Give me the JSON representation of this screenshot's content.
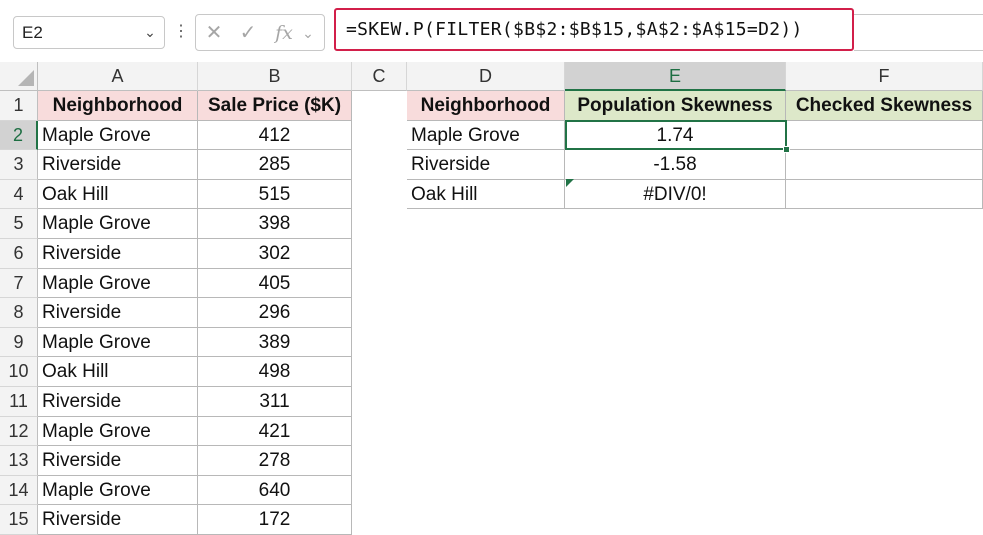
{
  "formula_bar": {
    "name_box": "E2",
    "cancel_icon": "✕",
    "enter_icon": "✓",
    "fx_icon": "fx",
    "formula": "=SKEW.P(FILTER($B$2:$B$15,$A$2:$A$15=D2))"
  },
  "columns": [
    "A",
    "B",
    "C",
    "D",
    "E",
    "F"
  ],
  "rows": [
    "1",
    "2",
    "3",
    "4",
    "5",
    "6",
    "7",
    "8",
    "9",
    "10",
    "11",
    "12",
    "13",
    "14",
    "15"
  ],
  "table_left": {
    "headers": [
      "Neighborhood",
      "Sale Price ($K)"
    ],
    "data": [
      [
        "Maple Grove",
        "412"
      ],
      [
        "Riverside",
        "285"
      ],
      [
        "Oak Hill",
        "515"
      ],
      [
        "Maple Grove",
        "398"
      ],
      [
        "Riverside",
        "302"
      ],
      [
        "Maple Grove",
        "405"
      ],
      [
        "Riverside",
        "296"
      ],
      [
        "Maple Grove",
        "389"
      ],
      [
        "Oak Hill",
        "498"
      ],
      [
        "Riverside",
        "311"
      ],
      [
        "Maple Grove",
        "421"
      ],
      [
        "Riverside",
        "278"
      ],
      [
        "Maple Grove",
        "640"
      ],
      [
        "Riverside",
        "172"
      ]
    ]
  },
  "table_right": {
    "headers": [
      "Neighborhood",
      "Population Skewness",
      "Checked Skewness"
    ],
    "data": [
      [
        "Maple Grove",
        "1.74",
        ""
      ],
      [
        "Riverside",
        "-1.58",
        ""
      ],
      [
        "Oak Hill",
        "#DIV/0!",
        ""
      ]
    ]
  },
  "colors": {
    "accent": "#217346",
    "highlight_border": "#d21f4a",
    "header_pink": "#f8dcdc",
    "header_green": "#dde8c9"
  }
}
